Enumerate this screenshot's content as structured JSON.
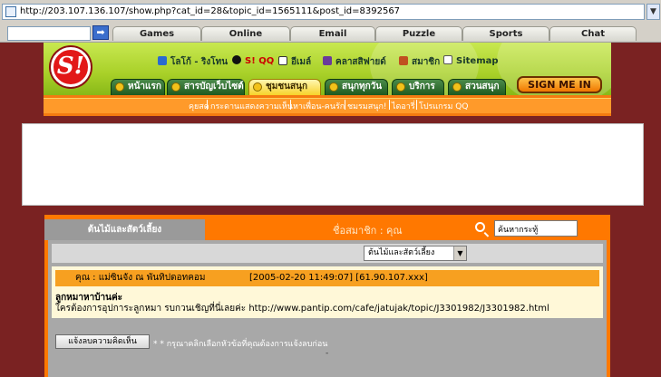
{
  "browser": {
    "url": "http://203.107.136.107/show.php?cat_id=28&topic_id=1565111&post_id=8392567",
    "go_label": "➡",
    "tabs": [
      "Games",
      "Online",
      "Email",
      "Puzzle",
      "Sports",
      "Chat"
    ]
  },
  "header": {
    "logo_text": "S!",
    "top_links": [
      "โลโก้ - ริงโทน",
      "S! QQ",
      "อีเมล์",
      "คลาสสิฟายด์",
      "สมาชิก",
      "Sitemap"
    ],
    "nav_tabs": [
      "หน้าแรก",
      "สารบัญเว็บไซต์",
      "ชุมชนสนุก",
      "สนุกทุกวัน",
      "บริการ",
      "สวนสนุก"
    ],
    "active_tab_index": 2,
    "sign_in": "SIGN ME IN",
    "sub_nav": [
      "คุยสด",
      "กระดานแสดงความเห็น",
      "หาเพื่อน-คนรัก",
      "ชมรมสนุก!",
      "ไดอารี่",
      "โปรแกรม QQ"
    ]
  },
  "board": {
    "crumb": "ต้นไม้และสัตว์เลี้ยง",
    "member_label": "ชื่อสมาชิก : คุณ",
    "search_value": "ค้นหากระทู้",
    "category_select": "ต้นไม้และสัตว์เลี้ยง",
    "post": {
      "author": "คุณ : แม่ซินจัง ณ พันทิปดอทคอม",
      "datetime_ip": "[2005-02-20 11:49:07] [61.90.107.xxx]",
      "title": "ลูกหมาหาบ้านค่ะ",
      "body": "ใครต้องการอุปการะลูกหมา รบกวนเชิญที่นี่เลยค่ะ http://www.pantip.com/cafe/jatujak/topic/J3301982/J3301982.html"
    },
    "report_button": "แจ้งลบความคิดเห็น",
    "report_note": "* * กรุณาคลิกเลือกหัวข้อที่คุณต้องการแจ้งลบก่อน",
    "footer_dash": "-"
  }
}
